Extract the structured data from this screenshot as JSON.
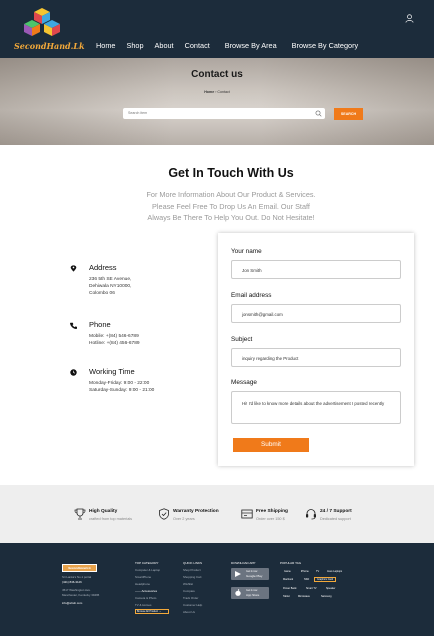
{
  "header": {
    "logo_text": "SecondHand.Lk",
    "nav": [
      "Home",
      "Shop",
      "About",
      "Contact",
      "Browse By Area",
      "Browse By Category"
    ]
  },
  "hero": {
    "title": "Contact us",
    "breadcrumb_home": "Home",
    "breadcrumb_current": "Contact",
    "search_placeholder": "Search item",
    "search_button": "SEARCH"
  },
  "contact": {
    "heading": "Get In Touch With Us",
    "subtext": [
      "For More Information About Our Product & Services.",
      "Please Feel Free To Drop Us An Email. Our Staff",
      "Always Be There To Help You Out. Do Not Hesitate!"
    ],
    "address": {
      "title": "Address",
      "lines": [
        "236 5th SE Avenue,",
        "Dehiwala  NY10000,",
        "Colombo 06"
      ]
    },
    "phone": {
      "title": "Phone",
      "lines": [
        "Mobile: +(84) 546-6789",
        "Hotline: +(84) 456-6789"
      ]
    },
    "hours": {
      "title": "Working Time",
      "lines": [
        "Monday-Friday: 9:00 - 22:00",
        "Saturday-Sunday: 9:00 - 21:00"
      ]
    }
  },
  "form": {
    "name_label": "Your name",
    "name_value": "Jon Smith",
    "email_label": "Email address",
    "email_value": "jonsmith@gmail.com",
    "subject_label": "Subject",
    "subject_value": "inquiry regarding the Product",
    "message_label": "Message",
    "message_value": "Hi! I'd like to know more details about the advertisement I posted recently",
    "submit_label": "Submit"
  },
  "features": [
    {
      "title": "High Quality",
      "sub": "crafted from top materials",
      "icon": "trophy-icon"
    },
    {
      "title": "Warranty Protection",
      "sub": "Over 2 years",
      "icon": "shield-check-icon"
    },
    {
      "title": "Free Shipping",
      "sub": "Order over 150 $",
      "icon": "shipping-icon"
    },
    {
      "title": "24 / 7 Support",
      "sub": "Dedicated support",
      "icon": "headset-icon"
    }
  ],
  "footer": {
    "logo_text": "SecondHand.Lk",
    "tagline": "Sri Lanka's No.1 portal",
    "phone": "(421) 846-3126",
    "addr1": "4517 Washington Ave.",
    "addr2": "Manchester, Kentucky 39495",
    "email": "info@ehub.com",
    "top_category": {
      "title": "TOP CATEGORY",
      "items": [
        "Computer & Laptop",
        "SmartPhone",
        "Headphone",
        "Accessories",
        "Camera & Photo",
        "TV & Homes"
      ],
      "browse": "Browse All Product"
    },
    "quick_links": {
      "title": "QUICK LINKS",
      "items": [
        "Shop Product",
        "Shopping Cart",
        "Wishlist",
        "Compare",
        "Track Order",
        "Customer Help",
        "About Us"
      ]
    },
    "download": {
      "title": "DOWNLOAD APP",
      "google": "Google Play",
      "apple": "App Store",
      "get": "Get it now"
    },
    "popular_tag": {
      "title": "POPULAR TAG",
      "row1": [
        "Game",
        "iPhone",
        "TV",
        "Asus Laptops"
      ],
      "row2": [
        "Macbook",
        "SSD",
        "Graphics Card"
      ],
      "row3": [
        "Power Bank",
        "Smart TV",
        "Speaker"
      ],
      "row4": [
        "Tablet",
        "Microwave",
        "Samsung"
      ]
    }
  },
  "colors": {
    "accent": "#f07a1a",
    "dark": "#1c2c3b"
  }
}
